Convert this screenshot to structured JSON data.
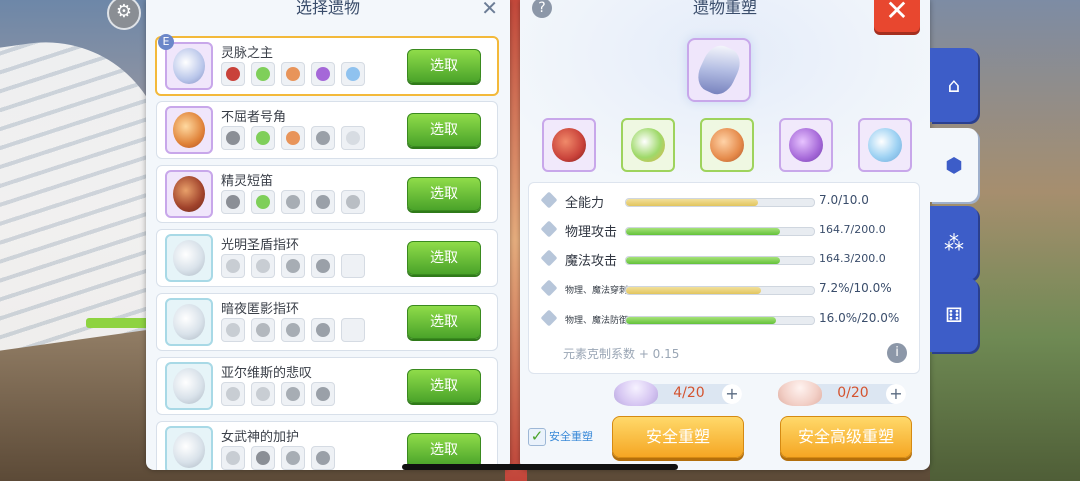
{
  "left_panel": {
    "title": "选择遗物",
    "close_glyph": "✕",
    "badge": "E",
    "items": [
      {
        "name": "灵脉之主",
        "button": "选取"
      },
      {
        "name": "不屈者号角",
        "button": "选取"
      },
      {
        "name": "精灵短笛",
        "button": "选取"
      },
      {
        "name": "光明圣盾指环",
        "button": "选取"
      },
      {
        "name": "暗夜匿影指环",
        "button": "选取"
      },
      {
        "name": "亚尔维斯的悲叹",
        "button": "选取"
      },
      {
        "name": "女武神的加护",
        "button": "选取"
      }
    ]
  },
  "right_panel": {
    "title": "遗物重塑",
    "help_glyph": "?",
    "close_glyph": "✕",
    "stats": [
      {
        "label": "全能力",
        "value": "7.0/10.0",
        "fill": 0.7,
        "color": "yellow"
      },
      {
        "label": "物理攻击",
        "value": "164.7/200.0",
        "fill": 0.82,
        "color": "green"
      },
      {
        "label": "魔法攻击",
        "value": "164.3/200.0",
        "fill": 0.82,
        "color": "green"
      },
      {
        "label": "物理、魔法穿刺",
        "value": "7.2%/10.0%",
        "fill": 0.72,
        "color": "yellow"
      },
      {
        "label": "物理、魔法防御",
        "value": "16.0%/20.0%",
        "fill": 0.8,
        "color": "green"
      }
    ],
    "coefficient": "元素克制系数 + 0.15",
    "info_glyph": "i",
    "costs": [
      {
        "count": "4/20",
        "plus": "+"
      },
      {
        "count": "0/20",
        "plus": "+"
      }
    ],
    "safe_checkbox_label": "安全重塑",
    "safe_button": "安全重塑",
    "safe_advanced_button": "安全高级重塑"
  },
  "colors": {
    "accent_green": "#4aa32a",
    "accent_orange": "#f5a623",
    "close_red": "#e8472f",
    "tab_blue": "#3d5dc8"
  },
  "icons": {
    "side_tabs": [
      "shop-icon",
      "hexagon-icon",
      "nodes-icon",
      "dice-icon"
    ]
  }
}
